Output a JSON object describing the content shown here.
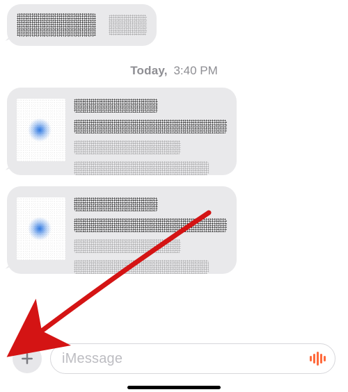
{
  "separator": {
    "day": "Today,",
    "time": "3:40 PM"
  },
  "toolbar": {
    "plus_label": "+"
  },
  "composer": {
    "placeholder": "iMessage"
  },
  "colors": {
    "bubble_bg": "#e9e9eb",
    "placeholder": "#bdbdc2",
    "mic_accent": "#ff6a3c",
    "plus_bg": "#e7e7ea",
    "annotation_arrow": "#d41414",
    "link_blue": "#2f7ae5"
  },
  "messages": [
    {
      "type": "incoming",
      "kind": "redacted-text"
    },
    {
      "type": "incoming",
      "kind": "redacted-link-preview"
    },
    {
      "type": "incoming",
      "kind": "redacted-link-preview"
    }
  ],
  "annotation": {
    "kind": "arrow",
    "target": "plus-button"
  }
}
